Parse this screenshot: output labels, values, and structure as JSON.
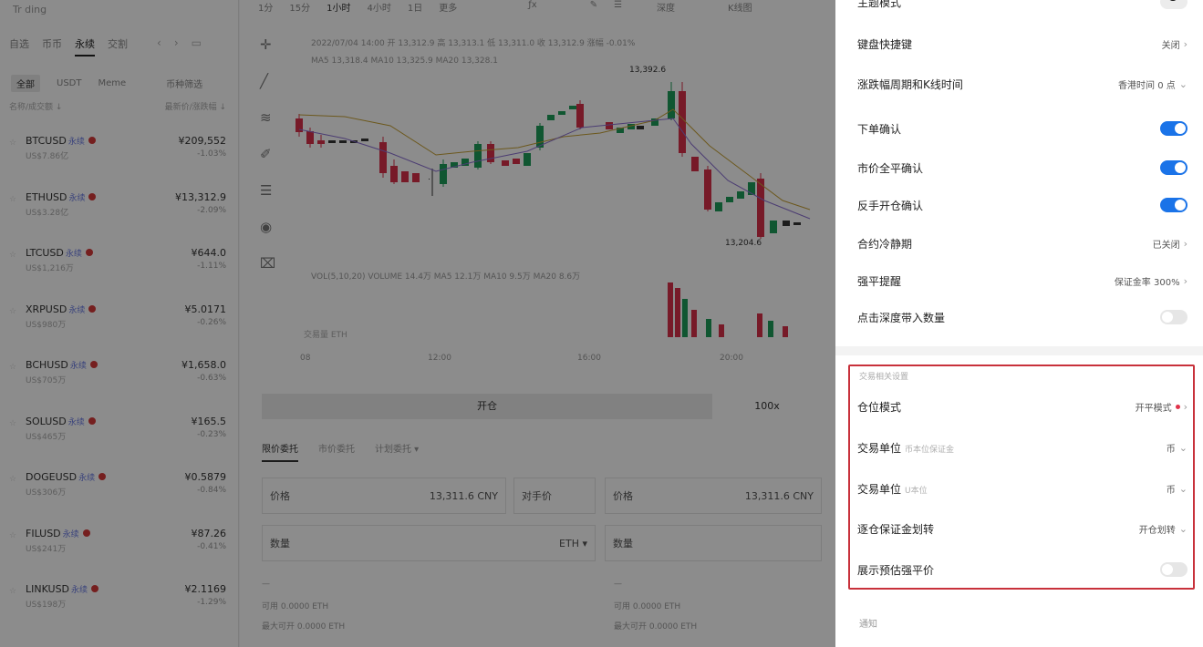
{
  "left_panel": {
    "top_title": "Tr ding",
    "tabs": [
      {
        "label": "自选",
        "active": false
      },
      {
        "label": "币币",
        "active": false
      },
      {
        "label": "永续",
        "active": true
      },
      {
        "label": "交割",
        "active": false
      }
    ],
    "filters": [
      {
        "label": "全部",
        "active": true
      },
      {
        "label": "USDT",
        "active": false
      },
      {
        "label": "Meme",
        "active": false
      },
      {
        "label": "币种筛选",
        "active": false
      }
    ],
    "col_name": "名称/成交额 ↓",
    "col_price": "最新价/涨跌幅 ↓",
    "markets": [
      {
        "symbol": "BTCUSD",
        "tag": "永续",
        "sub": "US$7.86亿",
        "price": "¥209,552",
        "change": "-1.03%"
      },
      {
        "symbol": "ETHUSD",
        "tag": "永续",
        "sub": "US$3.28亿",
        "price": "¥13,312.9",
        "change": "-2.09%"
      },
      {
        "symbol": "LTCUSD",
        "tag": "永续",
        "sub": "US$1,216万",
        "price": "¥644.0",
        "change": "-1.11%"
      },
      {
        "symbol": "XRPUSD",
        "tag": "永续",
        "sub": "US$980万",
        "price": "¥5.0171",
        "change": "-0.26%"
      },
      {
        "symbol": "BCHUSD",
        "tag": "永续",
        "sub": "US$705万",
        "price": "¥1,658.0",
        "change": "-0.63%"
      },
      {
        "symbol": "SOLUSD",
        "tag": "永续",
        "sub": "US$465万",
        "price": "¥165.5",
        "change": "-0.23%"
      },
      {
        "symbol": "DOGEUSD",
        "tag": "永续",
        "sub": "US$306万",
        "price": "¥0.5879",
        "change": "-0.84%"
      },
      {
        "symbol": "FILUSD",
        "tag": "永续",
        "sub": "US$241万",
        "price": "¥87.26",
        "change": "-0.41%"
      },
      {
        "symbol": "LINKUSD",
        "tag": "永续",
        "sub": "US$198万",
        "price": "¥2.1169",
        "change": "-1.29%"
      }
    ]
  },
  "center_panel": {
    "timeframes": [
      {
        "label": "1分",
        "active": false
      },
      {
        "label": "15分",
        "active": false
      },
      {
        "label": "1小时",
        "active": true
      },
      {
        "label": "4小时",
        "active": false
      },
      {
        "label": "1日",
        "active": false
      },
      {
        "label": "更多",
        "active": false
      }
    ],
    "right_tools": [
      "深度",
      "K线图"
    ],
    "indicator_line1": "2022/07/04 14:00 开 13,312.9 高 13,313.1 低 13,311.0 收 13,312.9 涨幅 -0.01%",
    "indicator_line2": "MA5 13,318.4  MA10 13,325.9  MA20 13,328.1",
    "indicator_line3": "VOL(5,10,20) VOLUME 14.4万 MA5 12.1万 MA10 9.5万 MA20 8.6万",
    "price_high_tag": "13,392.6",
    "price_low_tag": "13,204.6",
    "x_axis": [
      "08",
      "12:00",
      "16:00",
      "20:00"
    ],
    "left_note": "交易量 ETH",
    "buy_tab": "开仓",
    "leverage": "100x",
    "order_types": [
      "限价委托",
      "市价委托",
      "计划委托 ▾"
    ],
    "price_label": "价格",
    "price_value": "13,311.6 CNY",
    "price_label_right": "价格",
    "price_value_right": "13,311.6 CNY",
    "opponent": "对手价",
    "qty_label": "数量",
    "qty_unit": "ETH ▾",
    "qty_label_right": "数量",
    "avail_left": "可用 0.0000 ETH",
    "avail_left2": "最大可开 0.0000 ETH",
    "avail_right": "可用 0.0000 ETH",
    "avail_right2": "最大可开 0.0000 ETH",
    "tick_left": "—",
    "tick_right": "—"
  },
  "settings_panel": {
    "rows": [
      {
        "label": "主题模式",
        "type": "toggle-top"
      },
      {
        "label": "键盘快捷键",
        "value": "关闭",
        "type": "link"
      },
      {
        "label": "涨跌幅周期和K线时间",
        "value": "香港时间 0 点",
        "type": "dropdown"
      },
      {
        "label": "下单确认",
        "type": "toggle",
        "on": true
      },
      {
        "label": "市价全平确认",
        "type": "toggle",
        "on": true
      },
      {
        "label": "反手开仓确认",
        "type": "toggle",
        "on": true
      },
      {
        "label": "合约冷静期",
        "value": "已关闭",
        "type": "link"
      },
      {
        "label": "强平提醒",
        "value": "保证金率 300%",
        "type": "link"
      },
      {
        "label": "点击深度带入数量",
        "type": "toggle",
        "on": false
      }
    ],
    "section_title": "交易相关设置",
    "section_rows": [
      {
        "label": "仓位模式",
        "value": "开平模式",
        "type": "link-dot"
      },
      {
        "label": "交易单位",
        "hint": "币本位保证金",
        "value": "币",
        "type": "dropdown"
      },
      {
        "label": "交易单位",
        "hint": "U本位",
        "value": "币",
        "type": "dropdown"
      },
      {
        "label": "逐仓保证金划转",
        "value": "开仓划转",
        "type": "dropdown"
      },
      {
        "label": "展示预估强平价",
        "type": "toggle",
        "on": false
      }
    ],
    "bottom_section": "通知"
  },
  "colors": {
    "accent": "#1a73e8",
    "highlight_border": "#c8313b",
    "candle_up": "#1e9d5a",
    "candle_down": "#d9304a"
  }
}
